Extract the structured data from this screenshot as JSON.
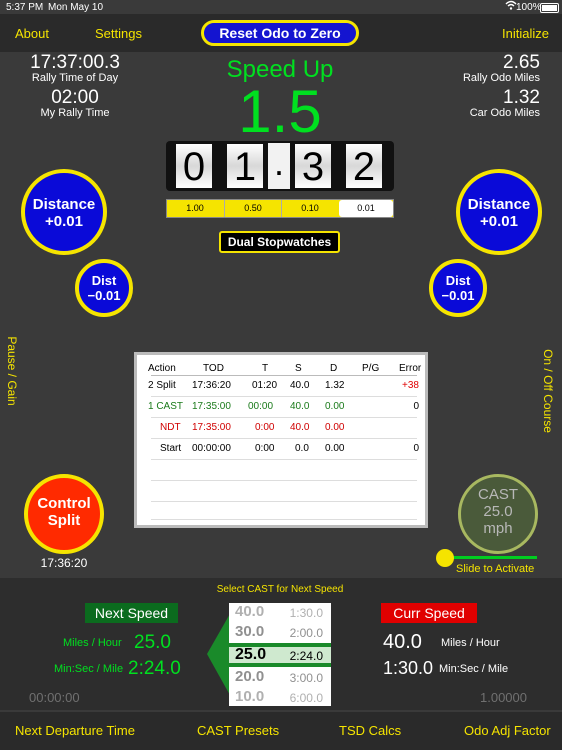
{
  "status_bar": {
    "time": "5:37 PM",
    "date": "Mon May 10",
    "battery": "100%"
  },
  "top_nav": {
    "about": "About",
    "settings": "Settings",
    "reset": "Reset Odo to Zero",
    "initialize": "Initialize"
  },
  "left_info": {
    "rally_time": "17:37:00.3",
    "rally_time_label": "Rally Time of Day",
    "my_time": "02:00",
    "my_time_label": "My Rally Time"
  },
  "right_info": {
    "rally_odo": "2.65",
    "rally_odo_label": "Rally Odo Miles",
    "car_odo": "1.32",
    "car_odo_label": "Car Odo Miles"
  },
  "speed": {
    "status": "Speed Up",
    "value": "1.5"
  },
  "odometer": {
    "digits": [
      "0",
      "1",
      "3",
      "2"
    ],
    "dot": "."
  },
  "increments": {
    "items": [
      "1.00",
      "0.50",
      "0.10",
      "0.01"
    ],
    "selected": "0.01"
  },
  "buttons": {
    "distance_plus_title": "Distance",
    "distance_plus_value": "+0.01",
    "dist_minus_title": "Dist",
    "dist_minus_value": "−0.01",
    "dual_stopwatches": "Dual Stopwatches",
    "control_split_line1": "Control",
    "control_split_line2": "Split",
    "control_split_time": "17:36:20",
    "cast_line1": "CAST",
    "cast_line2": "25.0",
    "cast_line3": "mph",
    "slide_label": "Slide to Activate"
  },
  "side_labels": {
    "left": "Pause / Gain",
    "right": "On / Off Course"
  },
  "table": {
    "headers": [
      "Action",
      "TOD",
      "T",
      "S",
      "D",
      "P/G",
      "Error"
    ],
    "rows": [
      {
        "action": "2 Split",
        "tod": "17:36:20",
        "t": "01:20",
        "s": "40.0",
        "d": "1.32",
        "pg": "",
        "error": "+38",
        "color": "#000000",
        "error_color": "#e00000"
      },
      {
        "action": "1 CAST",
        "tod": "17:35:00",
        "t": "00:00",
        "s": "40.0",
        "d": "0.00",
        "pg": "",
        "error": "0",
        "color": "#1a7a1a",
        "error_color": "#000000"
      },
      {
        "action": "NDT",
        "tod": "17:35:00",
        "t": "0:00",
        "s": "40.0",
        "d": "0.00",
        "pg": "",
        "error": "",
        "color": "#d00000",
        "error_color": "#000000"
      },
      {
        "action": "Start",
        "tod": "00:00:00",
        "t": "0:00",
        "s": "0.0",
        "d": "0.00",
        "pg": "",
        "error": "0",
        "color": "#000000",
        "error_color": "#000000"
      }
    ]
  },
  "bottom": {
    "select_label": "Select CAST for Next Speed",
    "next_speed_title": "Next Speed",
    "next_mph_label": "Miles / Hour",
    "next_mph": "25.0",
    "next_pace_label": "Min:Sec / Mile",
    "next_pace": "2:24.0",
    "left_timer": "00:00:00",
    "curr_speed_title": "Curr Speed",
    "curr_mph": "40.0",
    "curr_mph_label": "Miles / Hour",
    "curr_pace": "1:30.0",
    "curr_pace_label": "Min:Sec / Mile",
    "odo_factor": "1.00000"
  },
  "picker": {
    "rows": [
      {
        "speed": "40.0",
        "pace": "1:30.0"
      },
      {
        "speed": "30.0",
        "pace": "2:00.0"
      },
      {
        "speed": "25.0",
        "pace": "2:24.0"
      },
      {
        "speed": "20.0",
        "pace": "3:00.0"
      },
      {
        "speed": "10.0",
        "pace": "6:00.0"
      }
    ],
    "selected_index": 2
  },
  "bottom_nav": {
    "next_departure": "Next Departure Time",
    "cast_presets": "CAST Presets",
    "tsd_calcs": "TSD Calcs",
    "odo_adj": "Odo Adj Factor"
  },
  "colors": {
    "accent": "#f5e400",
    "primary_button": "#0a0ad8",
    "alert": "#e00000",
    "speed_green": "#00e020"
  }
}
